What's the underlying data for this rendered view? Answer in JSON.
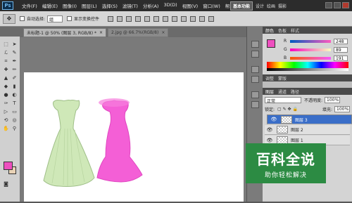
{
  "app": {
    "logo": "Ps"
  },
  "menu": [
    "文件(F)",
    "编辑(E)",
    "图像(I)",
    "图层(L)",
    "选择(S)",
    "滤镜(T)",
    "分析(A)",
    "3D(D)",
    "视图(V)",
    "窗口(W)",
    "帮助(H)"
  ],
  "zoom": "50%",
  "workspace": {
    "active": "基本功能",
    "others": [
      "设计",
      "绘画",
      "摄影"
    ]
  },
  "options": {
    "auto_select_label": "自动选择:",
    "auto_select_value": "组",
    "show_transform_label": "显示变换控件"
  },
  "tabs": [
    {
      "label": "未标题-1 @ 50% (图层 3, RGB/8) *",
      "active": true
    },
    {
      "label": "2.jpg @ 66.7%(RGB/8)",
      "active": false
    }
  ],
  "colors": {
    "accent": "#ee4fbf",
    "bg": "#e9d2b6",
    "watermark": "#2c8b43"
  },
  "color_panel": {
    "tabs": [
      "颜色",
      "色板",
      "样式"
    ],
    "channels": [
      {
        "label": "R",
        "value": "248"
      },
      {
        "label": "G",
        "value": "89"
      },
      {
        "label": "B",
        "value": "191"
      }
    ]
  },
  "adjust_panel": {
    "tabs": [
      "调整",
      "蒙版"
    ]
  },
  "layers_panel": {
    "tabs": [
      "图层",
      "通道",
      "路径"
    ],
    "blend_mode": "正常",
    "opacity_label": "不透明度:",
    "opacity": "100%",
    "lock_label": "锁定:",
    "fill_label": "填充:",
    "fill": "100%",
    "layers": [
      {
        "name": "图层 3",
        "selected": true
      },
      {
        "name": "图层 2",
        "selected": false
      },
      {
        "name": "图层 1",
        "selected": false
      }
    ]
  },
  "watermark": {
    "title": "百科全说",
    "subtitle": "助你轻松解决"
  }
}
